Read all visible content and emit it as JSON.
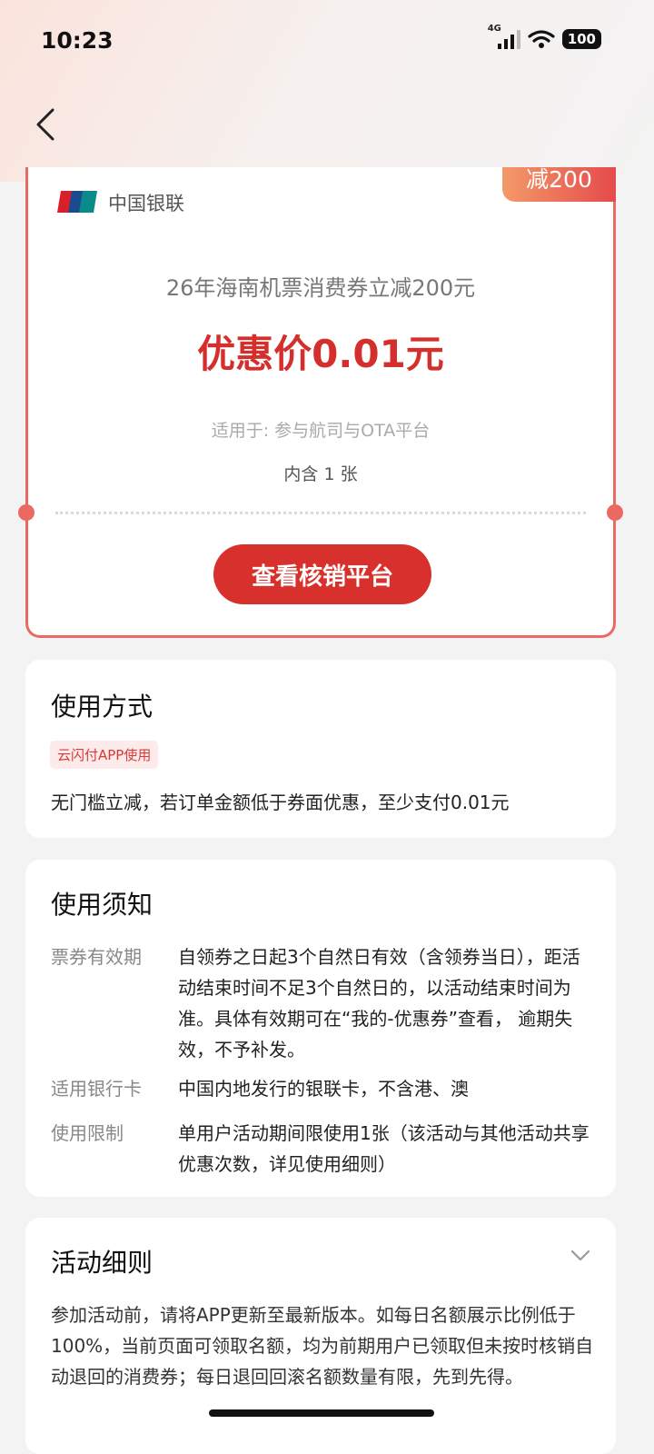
{
  "status_bar": {
    "time": "10:23",
    "network": "4G",
    "battery": "100"
  },
  "coupon": {
    "discount_tag": "减200",
    "brand": "中国银联",
    "title": "26年海南机票消费券立减200元",
    "price": "优惠价0.01元",
    "scope": "适用于: 参与航司与OTA平台",
    "count": "内含 1 张",
    "button_label": "查看核销平台",
    "accent_color": "#d8312d"
  },
  "usage": {
    "title": "使用方式",
    "tag": "云闪付APP使用",
    "description": "无门槛立减，若订单金额低于券面优惠，至少支付0.01元"
  },
  "notice": {
    "title": "使用须知",
    "rows": [
      {
        "label": "票券有效期",
        "value": "自领券之日起3个自然日有效（含领券当日），距活动结束时间不足3个自然日的，以活动结束时间为准。具体有效期可在“我的-优惠券”查看， 逾期失效，不予补发。"
      },
      {
        "label": "适用银行卡",
        "value": "中国内地发行的银联卡，不含港、澳"
      },
      {
        "label": "使用限制",
        "value": "单用户活动期间限使用1张（该活动与其他活动共享优惠次数，详见使用细则）"
      }
    ]
  },
  "rules": {
    "title": "活动细则",
    "text": "参加活动前，请将APP更新至最新版本。如每日名额展示比例低于100%，当前页面可领取名额，均为前期用户已领取但未按时核销自动退回的消费券；每日退回回滚名额数量有限，先到先得。"
  }
}
